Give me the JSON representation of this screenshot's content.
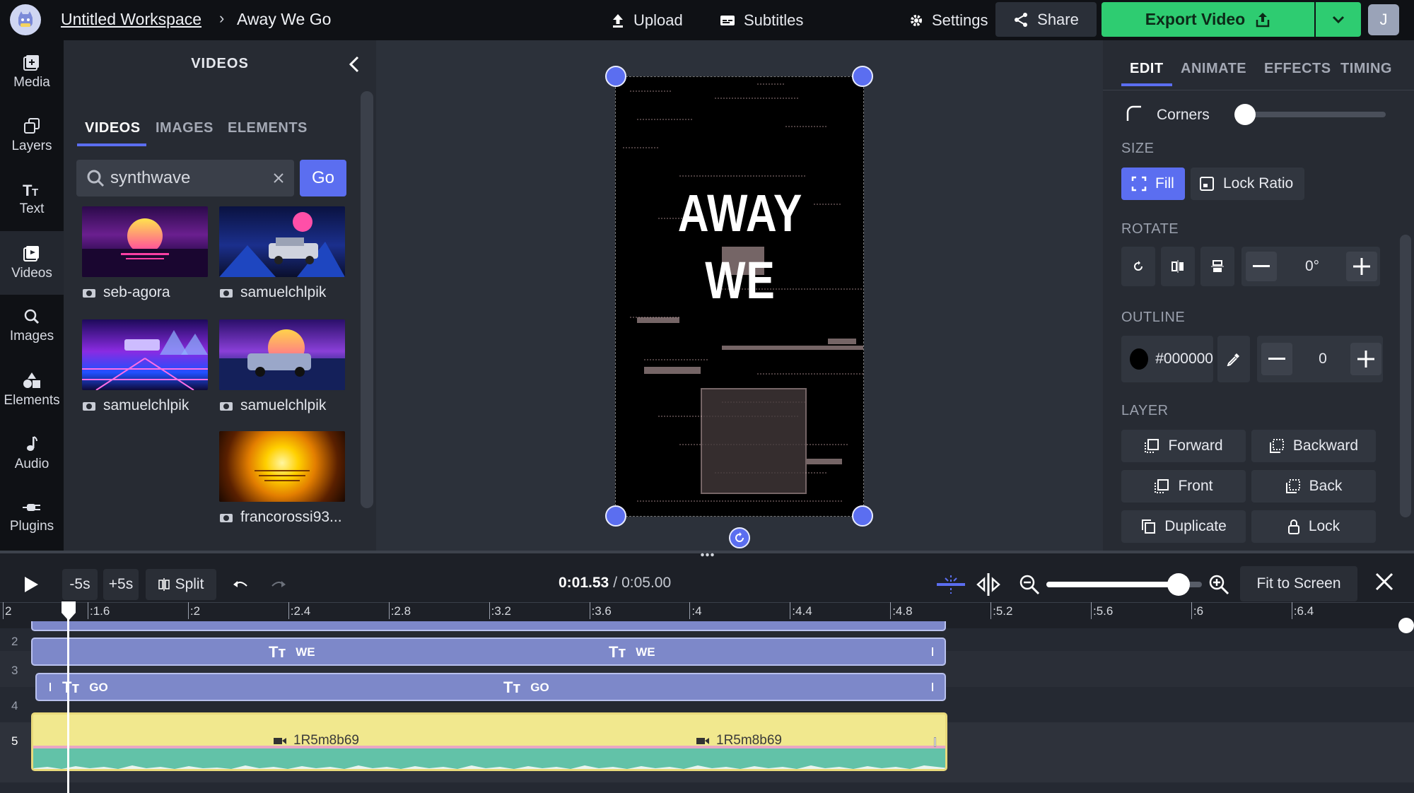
{
  "topbar": {
    "workspace": "Untitled Workspace",
    "separator": "›",
    "project": "Away We Go",
    "upload": "Upload",
    "subtitles": "Subtitles",
    "settings": "Settings",
    "share": "Share",
    "export": "Export Video",
    "user_initial": "J",
    "colors": {
      "export": "#2ecc71",
      "accent": "#5b6ef0"
    }
  },
  "rail": {
    "items": [
      {
        "label": "Media",
        "icon": "media-icon"
      },
      {
        "label": "Layers",
        "icon": "layers-icon"
      },
      {
        "label": "Text",
        "icon": "text-icon"
      },
      {
        "label": "Videos",
        "icon": "videos-icon"
      },
      {
        "label": "Images",
        "icon": "images-icon"
      },
      {
        "label": "Elements",
        "icon": "elements-icon"
      },
      {
        "label": "Audio",
        "icon": "audio-icon"
      },
      {
        "label": "Plugins",
        "icon": "plugins-icon"
      }
    ]
  },
  "library": {
    "title": "VIDEOS",
    "tabs": [
      "VIDEOS",
      "IMAGES",
      "ELEMENTS"
    ],
    "search_value": "synthwave",
    "go": "Go",
    "results": [
      {
        "author": "seb-agora"
      },
      {
        "author": "samuelchlpik"
      },
      {
        "author": "samuelchlpik"
      },
      {
        "author": "samuelchlpik"
      },
      {
        "author": "francorossi93..."
      }
    ]
  },
  "canvas": {
    "line1": "AWAY",
    "line2": "WE"
  },
  "inspector": {
    "tabs": [
      "EDIT",
      "ANIMATE",
      "EFFECTS",
      "TIMING"
    ],
    "corners": "Corners",
    "size_title": "SIZE",
    "fill": "Fill",
    "lock_ratio": "Lock Ratio",
    "rotate_title": "ROTATE",
    "rotate_value": "0°",
    "outline_title": "OUTLINE",
    "outline_color": "#000000",
    "outline_value": "0",
    "layer_title": "LAYER",
    "forward": "Forward",
    "backward": "Backward",
    "front": "Front",
    "back": "Back",
    "duplicate": "Duplicate",
    "lock": "Lock"
  },
  "timeline": {
    "minus5": "-5s",
    "plus5": "+5s",
    "split": "Split",
    "current": "0:01.53",
    "sep": "/",
    "total": "0:05.00",
    "fit": "Fit to Screen",
    "zoom_level": 0.85,
    "ticks": [
      "2",
      ":1.6",
      ":2",
      ":2.4",
      ":2.8",
      ":3.2",
      ":3.6",
      ":4",
      ":4.4",
      ":4.8",
      ":5.2",
      ":5.6",
      ":6",
      ":6.4"
    ],
    "rows": [
      "2",
      "3",
      "4",
      "5"
    ],
    "track3_labels": [
      "WE",
      "WE"
    ],
    "track4_labels": [
      "GO",
      "GO"
    ],
    "track5_labels": [
      "1R5m8b69",
      "1R5m8b69"
    ]
  }
}
